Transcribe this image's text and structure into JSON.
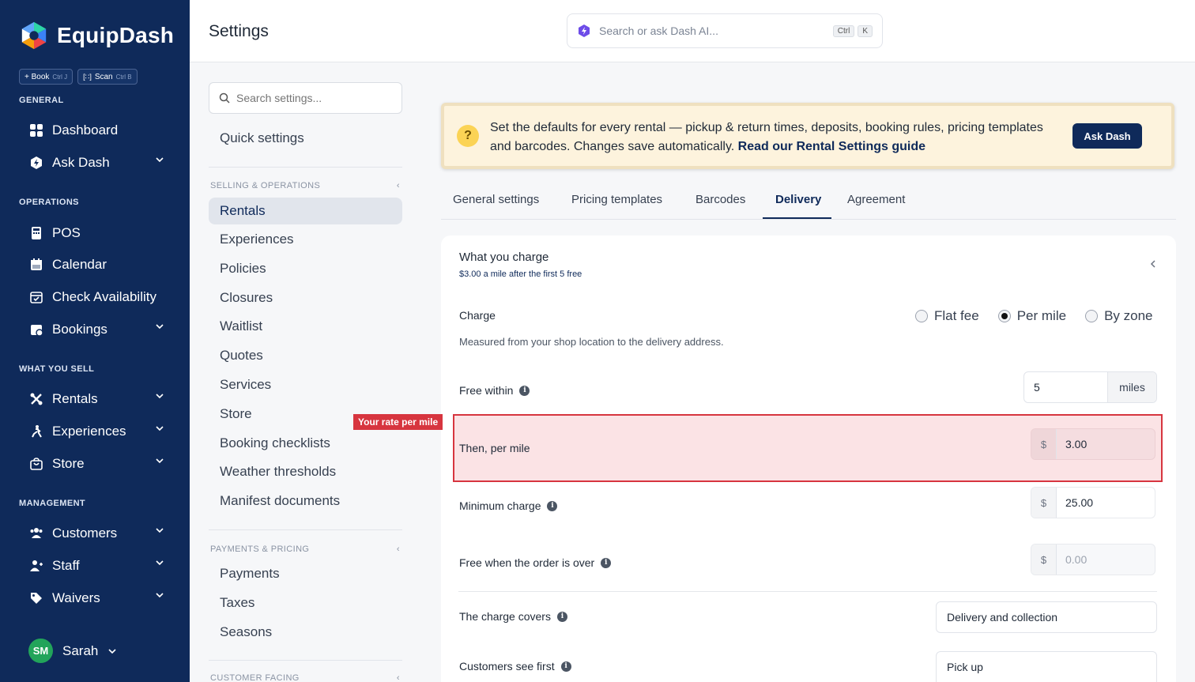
{
  "brand": {
    "name": "EquipDash"
  },
  "quick_actions": [
    {
      "label": "+ Book",
      "shortcut": "Ctrl J"
    },
    {
      "label": "Scan",
      "shortcut": "Ctrl B"
    }
  ],
  "sidebar": {
    "sections": {
      "general": "GENERAL",
      "operations": "OPERATIONS",
      "sell": "WHAT YOU SELL",
      "management": "MANAGEMENT"
    },
    "items": {
      "dashboard": "Dashboard",
      "ask_dash": "Ask Dash",
      "pos": "POS",
      "calendar": "Calendar",
      "check_availability": "Check Availability",
      "bookings": "Bookings",
      "rentals": "Rentals",
      "experiences": "Experiences",
      "store": "Store",
      "customers": "Customers",
      "staff": "Staff",
      "waivers": "Waivers"
    },
    "user": {
      "initials": "SM",
      "name": "Sarah"
    }
  },
  "topbar": {
    "title": "Settings",
    "search_placeholder": "Search or ask Dash AI...",
    "shortcut_ctrl": "Ctrl",
    "shortcut_key": "K"
  },
  "settings_nav": {
    "search_placeholder": "Search settings...",
    "quick_settings": "Quick settings",
    "section_selling": "SELLING & OPERATIONS",
    "selling_items": [
      "Rentals",
      "Experiences",
      "Policies",
      "Closures",
      "Waitlist",
      "Quotes",
      "Services",
      "Store",
      "Booking checklists",
      "Weather thresholds",
      "Manifest documents"
    ],
    "section_payments": "PAYMENTS & PRICING",
    "payments_items": [
      "Payments",
      "Taxes",
      "Seasons"
    ],
    "section_customer": "CUSTOMER FACING"
  },
  "banner": {
    "text": "Set the defaults for every rental — pickup & return times, deposits, booking rules, pricing templates and barcodes. Changes save automatically.",
    "link": "Read our Rental Settings guide",
    "button": "Ask Dash"
  },
  "tabs": [
    "General settings",
    "Pricing templates",
    "Barcodes",
    "Delivery",
    "Agreement"
  ],
  "active_tab": "Delivery",
  "delivery": {
    "title": "What you charge",
    "subtitle": "$3.00 a mile after the first 5 free",
    "charge_label": "Charge",
    "charge_options": [
      "Flat fee",
      "Per mile",
      "By zone"
    ],
    "charge_selected": "Per mile",
    "charge_description": "Measured from your shop location to the delivery address.",
    "free_within_label": "Free within",
    "free_within_value": "5",
    "free_within_unit": "miles",
    "per_mile_label": "Then, per mile",
    "per_mile_currency": "$",
    "per_mile_value": "3.00",
    "minimum_label": "Minimum charge",
    "minimum_currency": "$",
    "minimum_value": "25.00",
    "free_over_label": "Free when the order is over",
    "free_over_currency": "$",
    "free_over_placeholder": "0.00",
    "covers_label": "The charge covers",
    "covers_value": "Delivery and collection",
    "customers_see_label": "Customers see first",
    "customers_see_value": "Pick up"
  },
  "annotation": {
    "label": "Your rate per mile",
    "color": "#d7353f"
  },
  "colors": {
    "sidebar": "#0f2a5a",
    "accent": "#0f2a5a",
    "avatar": "#22a45a",
    "banner_bg": "#fdf3dd"
  }
}
